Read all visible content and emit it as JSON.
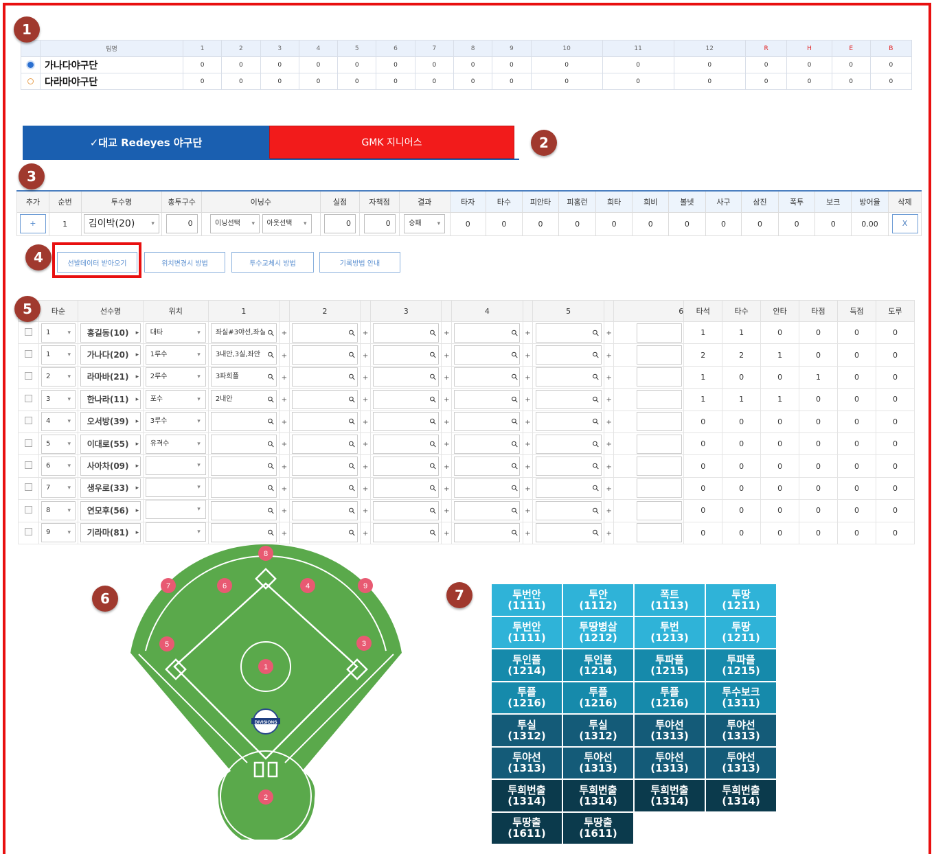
{
  "badges": [
    "1",
    "2",
    "3",
    "4",
    "5",
    "6",
    "7"
  ],
  "scoreboard": {
    "headers": [
      "팀명",
      "1",
      "2",
      "3",
      "4",
      "5",
      "6",
      "7",
      "8",
      "9",
      "10",
      "11",
      "12",
      "R",
      "H",
      "E",
      "B"
    ],
    "rows": [
      {
        "team": "가나다야구단",
        "scores": [
          "0",
          "0",
          "0",
          "0",
          "0",
          "0",
          "0",
          "0",
          "0",
          "0",
          "0",
          "0",
          "0",
          "0",
          "0",
          "0"
        ]
      },
      {
        "team": "다라마야구단",
        "scores": [
          "0",
          "0",
          "0",
          "0",
          "0",
          "0",
          "0",
          "0",
          "0",
          "0",
          "0",
          "0",
          "0",
          "0",
          "0",
          "0"
        ]
      }
    ]
  },
  "tabs": {
    "home": "✓대교 Redeyes 야구단",
    "away": "GMK 지니어스"
  },
  "pitching": {
    "headers": [
      "추가",
      "순번",
      "투수명",
      "총투구수",
      "이닝수",
      "실점",
      "자책점",
      "결과",
      "타자",
      "타수",
      "피안타",
      "피홈런",
      "희타",
      "희비",
      "볼넷",
      "사구",
      "삼진",
      "폭투",
      "보크",
      "방어율",
      "삭제"
    ],
    "row": {
      "add": "+",
      "order": "1",
      "name": "김이박(20)",
      "pitches": "0",
      "inning_sel": "이닝선택",
      "out_sel": "아웃선택",
      "runs": "0",
      "earned": "0",
      "result": "승패",
      "stats": [
        "0",
        "0",
        "0",
        "0",
        "0",
        "0",
        "0",
        "0",
        "0",
        "0",
        "0"
      ],
      "era": "0.00",
      "delete": "X"
    }
  },
  "buttons": [
    "선발데이터 받아오기",
    "위치변경시 방법",
    "투수교체시 방법",
    "기록방법 안내"
  ],
  "batting": {
    "headers": [
      "타순",
      "선수명",
      "위치",
      "1",
      "2",
      "3",
      "4",
      "5",
      "6",
      "타석",
      "타수",
      "안타",
      "타점",
      "득점",
      "도루"
    ],
    "rows": [
      {
        "order": "1",
        "name": "홍길동(10)",
        "pos": "대타",
        "in1": "좌실#3야선,좌실",
        "stats": [
          "1",
          "1",
          "0",
          "0",
          "0",
          "0"
        ]
      },
      {
        "order": "1",
        "name": "가나다(20)",
        "pos": "1루수",
        "in1": "3내안,3실,좌안",
        "stats": [
          "2",
          "2",
          "1",
          "0",
          "0",
          "0"
        ]
      },
      {
        "order": "2",
        "name": "라마바(21)",
        "pos": "2루수",
        "in1": "3파희플",
        "stats": [
          "1",
          "0",
          "0",
          "1",
          "0",
          "0"
        ]
      },
      {
        "order": "3",
        "name": "한나라(11)",
        "pos": "포수",
        "in1": "2내안",
        "stats": [
          "1",
          "1",
          "1",
          "0",
          "0",
          "0"
        ]
      },
      {
        "order": "4",
        "name": "오서방(39)",
        "pos": "3루수",
        "in1": "",
        "stats": [
          "0",
          "0",
          "0",
          "0",
          "0",
          "0"
        ]
      },
      {
        "order": "5",
        "name": "이대로(55)",
        "pos": "유격수",
        "in1": "",
        "stats": [
          "0",
          "0",
          "0",
          "0",
          "0",
          "0"
        ]
      },
      {
        "order": "6",
        "name": "사아차(09)",
        "pos": "",
        "in1": "",
        "stats": [
          "0",
          "0",
          "0",
          "0",
          "0",
          "0"
        ]
      },
      {
        "order": "7",
        "name": "생우로(33)",
        "pos": "",
        "in1": "",
        "stats": [
          "0",
          "0",
          "0",
          "0",
          "0",
          "0"
        ]
      },
      {
        "order": "8",
        "name": "연모후(56)",
        "pos": "",
        "in1": "",
        "stats": [
          "0",
          "0",
          "0",
          "0",
          "0",
          "0"
        ]
      },
      {
        "order": "9",
        "name": "기라마(81)",
        "pos": "",
        "in1": "",
        "stats": [
          "0",
          "0",
          "0",
          "0",
          "0",
          "0"
        ]
      }
    ]
  },
  "field": {
    "positions": [
      "1",
      "2",
      "3",
      "4",
      "5",
      "6",
      "7",
      "8",
      "9"
    ],
    "logo": "DIVISIONS"
  },
  "codes": [
    {
      "label": "투번안",
      "code": "(1111)",
      "tone": "1"
    },
    {
      "label": "투안",
      "code": "(1112)",
      "tone": "1"
    },
    {
      "label": "폭트",
      "code": "(1113)",
      "tone": "1"
    },
    {
      "label": "투땅",
      "code": "(1211)",
      "tone": "1"
    },
    {
      "label": "투번안",
      "code": "(1111)",
      "tone": "1"
    },
    {
      "label": "투땅병살",
      "code": "(1212)",
      "tone": "1"
    },
    {
      "label": "투번",
      "code": "(1213)",
      "tone": "1"
    },
    {
      "label": "투땅",
      "code": "(1211)",
      "tone": "1"
    },
    {
      "label": "투인플",
      "code": "(1214)",
      "tone": "2"
    },
    {
      "label": "투인플",
      "code": "(1214)",
      "tone": "2"
    },
    {
      "label": "투파플",
      "code": "(1215)",
      "tone": "2"
    },
    {
      "label": "투파플",
      "code": "(1215)",
      "tone": "2"
    },
    {
      "label": "투플",
      "code": "(1216)",
      "tone": "2"
    },
    {
      "label": "투플",
      "code": "(1216)",
      "tone": "2"
    },
    {
      "label": "투플",
      "code": "(1216)",
      "tone": "2"
    },
    {
      "label": "투수보크",
      "code": "(1311)",
      "tone": "2"
    },
    {
      "label": "투실",
      "code": "(1312)",
      "tone": "3"
    },
    {
      "label": "투실",
      "code": "(1312)",
      "tone": "3"
    },
    {
      "label": "투야선",
      "code": "(1313)",
      "tone": "3"
    },
    {
      "label": "투야선",
      "code": "(1313)",
      "tone": "3"
    },
    {
      "label": "투야선",
      "code": "(1313)",
      "tone": "3"
    },
    {
      "label": "투야선",
      "code": "(1313)",
      "tone": "3"
    },
    {
      "label": "투야선",
      "code": "(1313)",
      "tone": "3"
    },
    {
      "label": "투야선",
      "code": "(1313)",
      "tone": "3"
    },
    {
      "label": "투희번출",
      "code": "(1314)",
      "tone": "4"
    },
    {
      "label": "투희번출",
      "code": "(1314)",
      "tone": "4"
    },
    {
      "label": "투희번출",
      "code": "(1314)",
      "tone": "4"
    },
    {
      "label": "투희번출",
      "code": "(1314)",
      "tone": "4"
    },
    {
      "label": "투땅출",
      "code": "(1611)",
      "tone": "4"
    },
    {
      "label": "투땅출",
      "code": "(1611)",
      "tone": "4"
    }
  ],
  "colors": {
    "tone1": "#2fb3d8",
    "tone2": "#168aab",
    "tone3": "#145b78",
    "tone4": "#0b3a4c",
    "field": "#5aa94b",
    "marker": "#e85a72",
    "frame": "#e81010"
  }
}
